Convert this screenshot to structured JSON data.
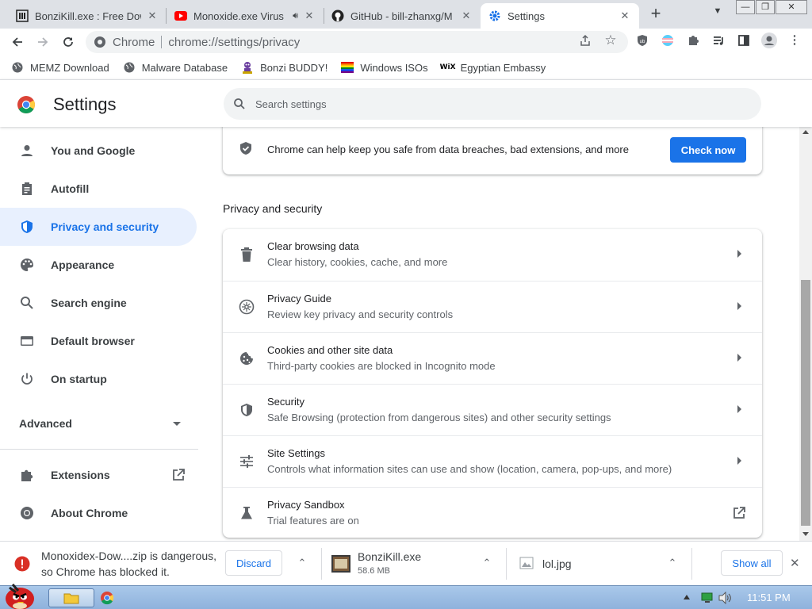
{
  "tabs": [
    {
      "title": "BonziKill.exe : Free Dow",
      "favicon": "archive-icon"
    },
    {
      "title": "Monoxide.exe Virus",
      "favicon": "youtube-icon",
      "audio": "speaker-icon"
    },
    {
      "title": "GitHub - bill-zhanxg/M",
      "favicon": "github-icon"
    },
    {
      "title": "Settings",
      "favicon": "gear-icon",
      "active": true
    }
  ],
  "window_controls": {
    "minimize": "—",
    "restore": "❐",
    "close": "✕"
  },
  "omnibox": {
    "site_label": "Chrome",
    "url": "chrome://settings/privacy"
  },
  "bookmarks": [
    {
      "label": "MEMZ Download",
      "icon": "globe-icon"
    },
    {
      "label": "Malware Database",
      "icon": "globe-icon"
    },
    {
      "label": "Bonzi BUDDY!",
      "icon": "bonzi-icon"
    },
    {
      "label": "Windows ISOs",
      "icon": "rainbow-flag-icon"
    },
    {
      "label": "Egyptian Embassy",
      "icon": "wix-icon"
    }
  ],
  "header": {
    "title": "Settings",
    "search_placeholder": "Search settings"
  },
  "sidebar": {
    "items": [
      {
        "label": "You and Google",
        "icon": "person-icon"
      },
      {
        "label": "Autofill",
        "icon": "clipboard-icon"
      },
      {
        "label": "Privacy and security",
        "icon": "shield-icon",
        "selected": true
      },
      {
        "label": "Appearance",
        "icon": "palette-icon"
      },
      {
        "label": "Search engine",
        "icon": "search-icon"
      },
      {
        "label": "Default browser",
        "icon": "browser-icon"
      },
      {
        "label": "On startup",
        "icon": "power-icon"
      }
    ],
    "advanced": "Advanced",
    "extensions": "Extensions",
    "about": "About Chrome"
  },
  "safety_check": {
    "text": "Chrome can help keep you safe from data breaches, bad extensions, and more",
    "button": "Check now"
  },
  "privacy": {
    "section_title": "Privacy and security",
    "rows": [
      {
        "title": "Clear browsing data",
        "subtitle": "Clear history, cookies, cache, and more",
        "icon": "trash-icon"
      },
      {
        "title": "Privacy Guide",
        "subtitle": "Review key privacy and security controls",
        "icon": "compass-icon"
      },
      {
        "title": "Cookies and other site data",
        "subtitle": "Third-party cookies are blocked in Incognito mode",
        "icon": "cookie-icon"
      },
      {
        "title": "Security",
        "subtitle": "Safe Browsing (protection from dangerous sites) and other security settings",
        "icon": "shield-icon"
      },
      {
        "title": "Site Settings",
        "subtitle": "Controls what information sites can use and show (location, camera, pop-ups, and more)",
        "icon": "sliders-icon"
      },
      {
        "title": "Privacy Sandbox",
        "subtitle": "Trial features are on",
        "icon": "flask-icon"
      }
    ]
  },
  "downloads": {
    "blocked_line1": "Monoxidex-Dow....zip is dangerous,",
    "blocked_line2": "so Chrome has blocked it.",
    "discard": "Discard",
    "item1_name": "BonziKill.exe",
    "item1_size": "58.6 MB",
    "item2_name": "lol.jpg",
    "show_all": "Show all"
  },
  "taskbar": {
    "clock": "11:51 PM"
  },
  "colors": {
    "accent": "#1a73e8",
    "selected_bg": "#e8f0fe",
    "danger": "#d93025"
  }
}
